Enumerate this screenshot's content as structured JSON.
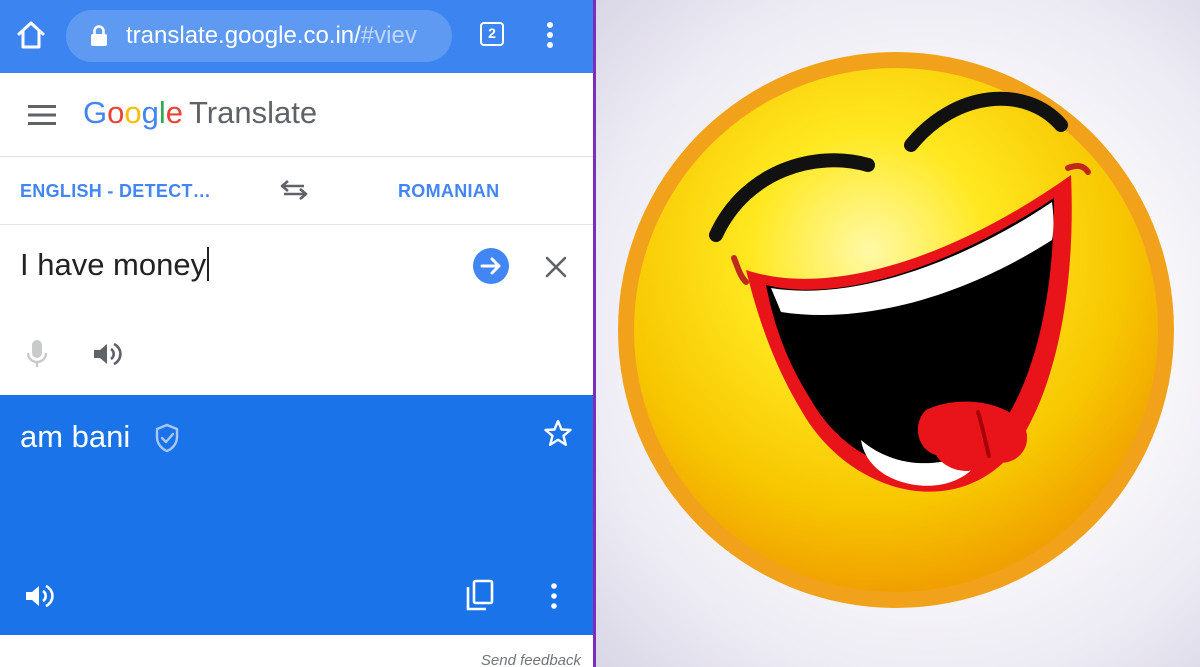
{
  "browser": {
    "url_visible": "translate.google.co.in/",
    "url_fade": "#viev",
    "tab_count": "2"
  },
  "app": {
    "logo_letters": [
      "G",
      "o",
      "o",
      "g",
      "l",
      "e"
    ],
    "title": "Translate"
  },
  "languages": {
    "source": "ENGLISH - DETECT…",
    "target": "ROMANIAN"
  },
  "input": {
    "text": "I have money"
  },
  "output": {
    "text": "am bani"
  },
  "footer": {
    "feedback_label": "Send feedback"
  },
  "colors": {
    "browser_bar": "#3c84f0",
    "accent": "#4285f4",
    "output_card": "#1a73e8",
    "divider": "#7b2fb8"
  },
  "icons": [
    "home-icon",
    "lock-icon",
    "tabs-icon",
    "more-vert-icon",
    "menu-icon",
    "swap-icon",
    "arrow-forward-icon",
    "close-icon",
    "mic-icon",
    "volume-icon",
    "verified-shield-icon",
    "star-icon",
    "copy-icon"
  ]
}
